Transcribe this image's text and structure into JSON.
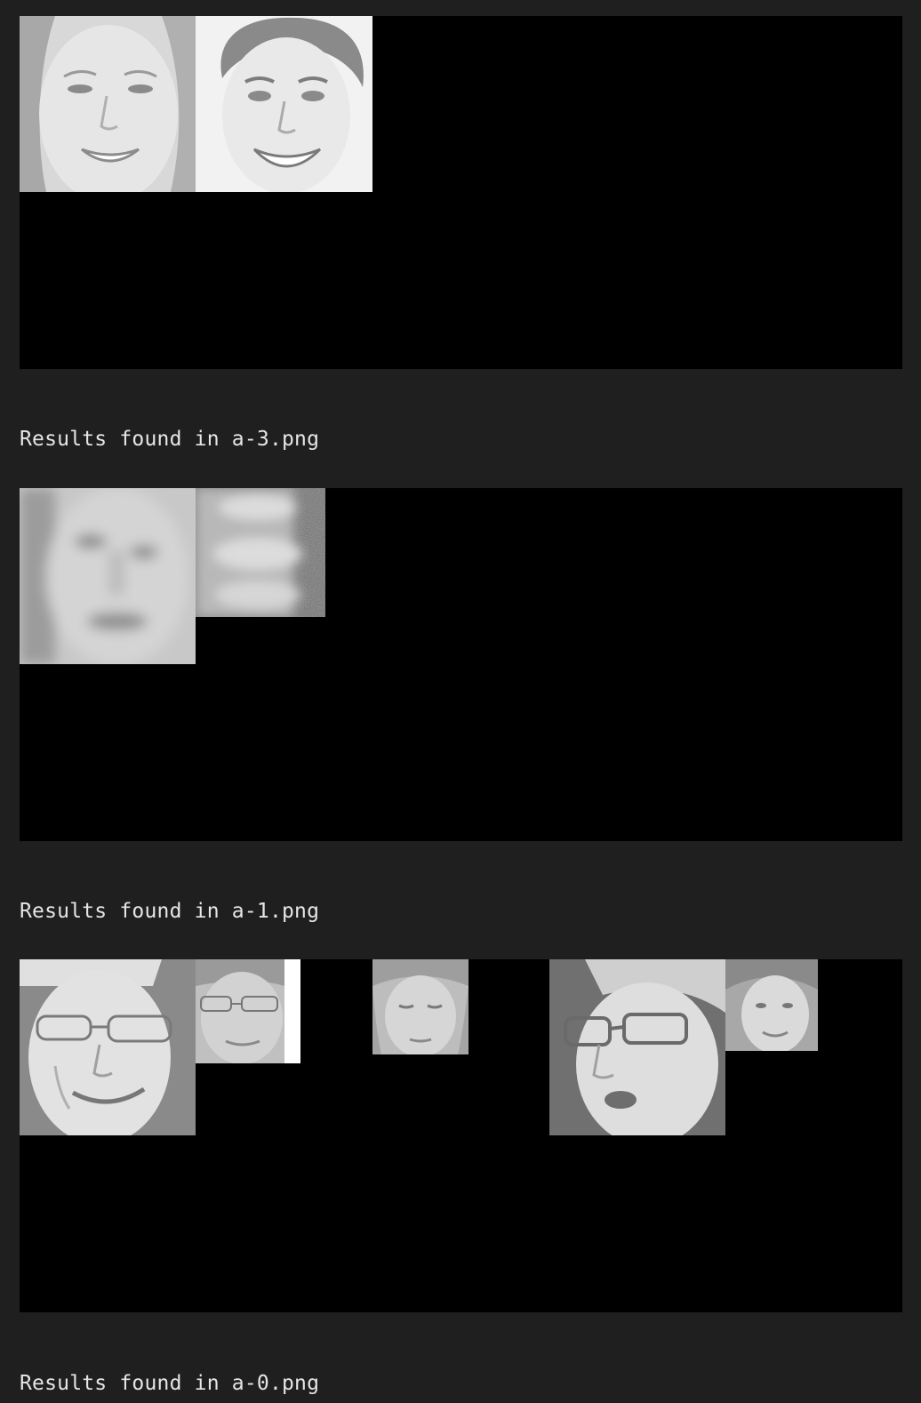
{
  "sections": [
    {
      "faces": [
        {
          "name": "face-thumbnail-woman-smiling"
        },
        {
          "name": "face-thumbnail-young-man-smiling"
        }
      ]
    },
    {
      "label": "Results found in a-3.png",
      "faces": [
        {
          "name": "face-thumbnail-blurred-man"
        },
        {
          "name": "face-thumbnail-noisy-pattern"
        }
      ]
    },
    {
      "label": "Results found in a-1.png",
      "faces": [
        {
          "name": "face-thumbnail-man-glasses-grimace"
        },
        {
          "name": "face-thumbnail-young-man-glasses"
        },
        {
          "name": "face-thumbnail-woman-looking-down"
        },
        {
          "name": "face-thumbnail-man-glasses-talking"
        },
        {
          "name": "face-thumbnail-woman-smiling-small"
        }
      ]
    },
    {
      "label": "Results found in a-0.png"
    }
  ],
  "colors": {
    "page_background": "#1f1f1f",
    "panel_background": "#000000",
    "label_text": "#e6e6e6"
  }
}
